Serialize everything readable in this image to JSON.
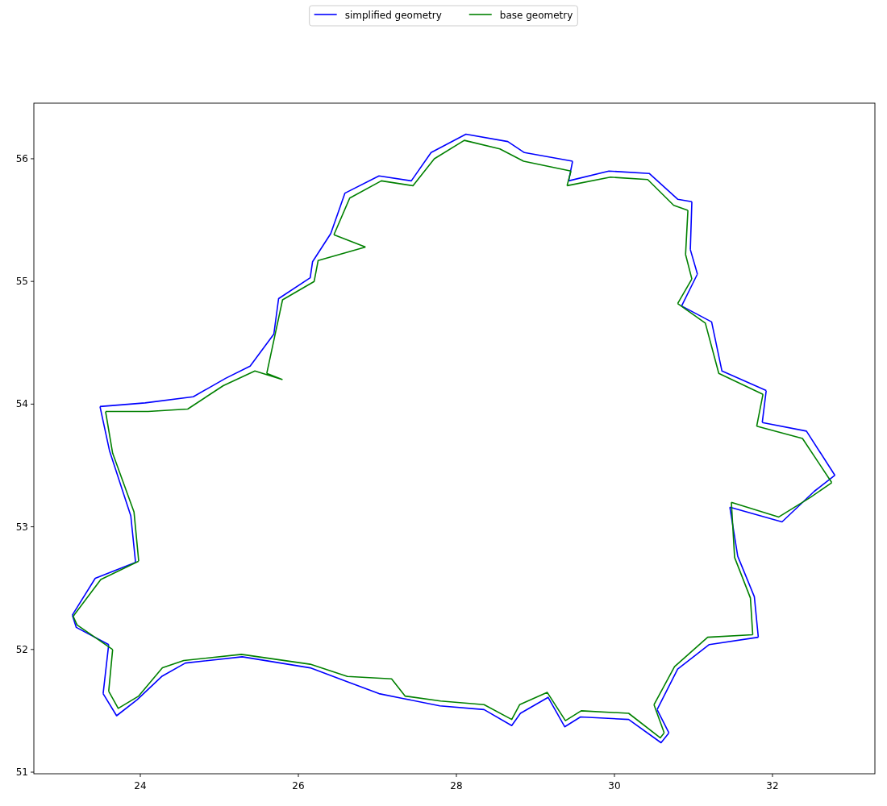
{
  "chart_data": {
    "type": "line",
    "legend": "upper center",
    "xlim": [
      22.653,
      33.296
    ],
    "ylim": [
      50.987,
      56.453
    ],
    "xticks": [
      24,
      26,
      28,
      30,
      32
    ],
    "yticks": [
      51,
      52,
      53,
      54,
      55,
      56
    ],
    "series": [
      {
        "name": "simplified geometry",
        "color": "#0000ff",
        "x": [
          23.14,
          23.43,
          23.94,
          23.88,
          23.61,
          23.49,
          24.06,
          24.67,
          25.08,
          25.39,
          25.69,
          25.75,
          26.15,
          26.18,
          26.41,
          26.59,
          27.02,
          27.43,
          27.68,
          28.12,
          28.65,
          28.86,
          29.47,
          29.42,
          29.93,
          30.44,
          30.8,
          30.98,
          30.96,
          31.05,
          30.85,
          31.23,
          31.36,
          31.92,
          31.87,
          32.43,
          32.79,
          32.53,
          32.12,
          31.46,
          31.56,
          31.77,
          31.82,
          31.2,
          30.8,
          30.54,
          30.69,
          30.59,
          30.18,
          29.57,
          29.37,
          29.16,
          28.81,
          28.7,
          28.35,
          27.79,
          27.33,
          27.02,
          26.61,
          26.15,
          25.29,
          24.57,
          24.27,
          23.96,
          23.7,
          23.53,
          23.6,
          23.19,
          23.14
        ],
        "values": [
          52.28,
          52.58,
          52.71,
          53.09,
          53.62,
          53.98,
          54.01,
          54.06,
          54.21,
          54.31,
          54.57,
          54.86,
          55.03,
          55.16,
          55.39,
          55.72,
          55.86,
          55.82,
          56.05,
          56.2,
          56.14,
          56.05,
          55.98,
          55.82,
          55.9,
          55.88,
          55.67,
          55.65,
          55.26,
          55.06,
          54.8,
          54.67,
          54.27,
          54.11,
          53.85,
          53.78,
          53.42,
          53.29,
          53.04,
          53.16,
          52.76,
          52.43,
          52.1,
          52.04,
          51.84,
          51.51,
          51.32,
          51.24,
          51.43,
          51.45,
          51.37,
          51.61,
          51.48,
          51.38,
          51.51,
          51.54,
          51.6,
          51.64,
          51.74,
          51.85,
          51.94,
          51.89,
          51.78,
          51.59,
          51.46,
          51.64,
          52.04,
          52.18,
          52.28
        ]
      },
      {
        "name": "base geometry",
        "color": "#008000",
        "x": [
          23.15,
          23.5,
          23.98,
          23.92,
          23.65,
          23.56,
          24.1,
          24.6,
          25.05,
          25.45,
          25.8,
          25.6,
          25.7,
          25.8,
          26.2,
          26.25,
          26.85,
          26.45,
          26.65,
          27.05,
          27.45,
          27.72,
          28.1,
          28.55,
          28.85,
          29.45,
          29.4,
          29.95,
          30.42,
          30.75,
          30.93,
          30.9,
          30.98,
          30.8,
          31.15,
          31.32,
          31.88,
          31.8,
          32.38,
          32.75,
          32.48,
          32.08,
          31.48,
          31.52,
          31.72,
          31.75,
          31.18,
          30.76,
          30.5,
          30.63,
          30.58,
          30.18,
          29.58,
          29.38,
          29.15,
          28.8,
          28.7,
          28.35,
          27.8,
          27.35,
          27.18,
          26.62,
          26.15,
          25.28,
          24.55,
          24.28,
          23.98,
          23.72,
          23.6,
          23.65,
          23.2,
          23.15
        ],
        "values": [
          52.27,
          52.57,
          52.72,
          53.12,
          53.6,
          53.94,
          53.94,
          53.96,
          54.15,
          54.27,
          54.2,
          54.25,
          54.55,
          54.85,
          55.0,
          55.17,
          55.28,
          55.38,
          55.68,
          55.82,
          55.78,
          56.0,
          56.15,
          56.08,
          55.98,
          55.9,
          55.78,
          55.85,
          55.83,
          55.62,
          55.58,
          55.22,
          55.02,
          54.82,
          54.66,
          54.25,
          54.08,
          53.82,
          53.72,
          53.36,
          53.24,
          53.08,
          53.2,
          52.75,
          52.42,
          52.12,
          52.1,
          51.86,
          51.55,
          51.32,
          51.28,
          51.48,
          51.5,
          51.42,
          51.65,
          51.55,
          51.43,
          51.55,
          51.58,
          51.62,
          51.76,
          51.78,
          51.88,
          51.96,
          51.91,
          51.85,
          51.62,
          51.52,
          51.66,
          52.0,
          52.2,
          52.27
        ]
      }
    ]
  }
}
